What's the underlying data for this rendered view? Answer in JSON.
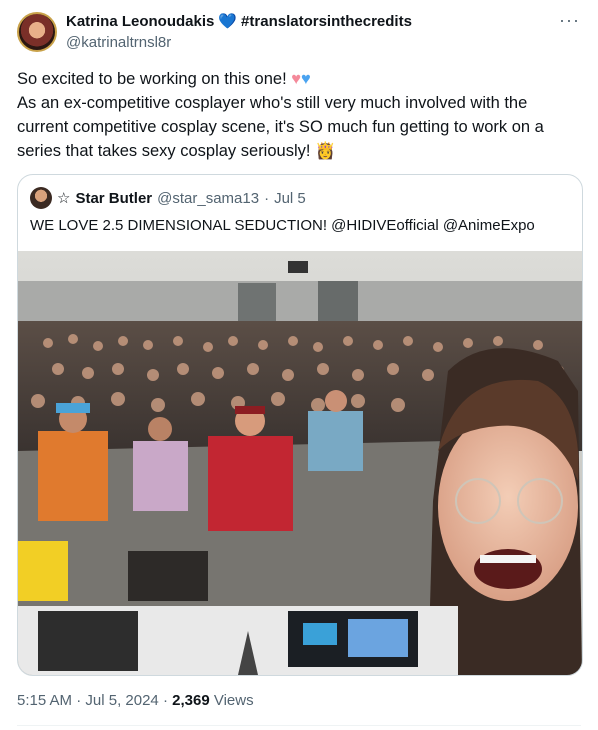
{
  "author": {
    "display_name": "Katrina Leonoudakis",
    "badge": "💙",
    "hashtag": "#translatorsinthecredits",
    "handle": "@katrinaltrnsl8r",
    "more_icon": "···"
  },
  "body": {
    "line1": "So excited to be working on this one! ",
    "heart_pink": "♥",
    "heart_blue": "♥",
    "line2": "As an ex-competitive cosplayer who's still very much involved with the current competitive cosplay scene, it's SO much fun getting to work on a series that takes sexy cosplay seriously! ",
    "emoji": "👸"
  },
  "quoted": {
    "star": "☆",
    "display_name": "Star Butler",
    "handle": "@star_sama13",
    "sep": "·",
    "date": "Jul 5",
    "text": "WE LOVE 2.5 DIMENSIONAL SEDUCTION! @HIDIVEofficial @AnimeExpo"
  },
  "footer": {
    "time": "5:15 AM",
    "sep1": "·",
    "date": "Jul 5, 2024",
    "sep2": "·",
    "views_count": "2,369",
    "views_label": "Views"
  },
  "colors": {
    "link_blue": "#1d9bf0",
    "muted": "#536471",
    "text": "#0f1419",
    "border": "#cfd9de"
  }
}
